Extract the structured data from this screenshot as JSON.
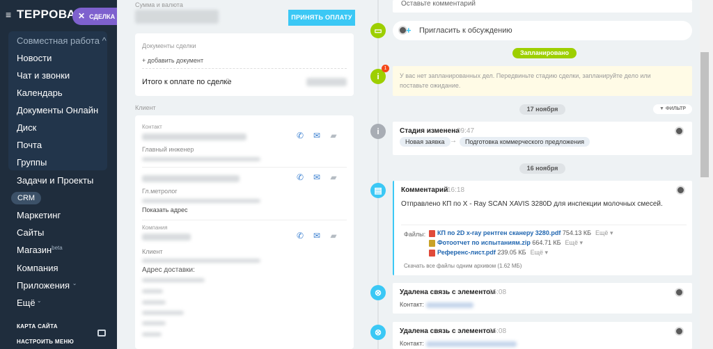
{
  "sidebar": {
    "brand": "ТЕРРОВАК",
    "deal_pill": "СДЕЛКА",
    "group_title": "Совместная работа",
    "items": [
      "Новости",
      "Чат и звонки",
      "Календарь",
      "Документы Онлайн",
      "Диск",
      "Почта",
      "Группы"
    ],
    "items2": [
      "Задачи и Проекты"
    ],
    "crm": "CRM",
    "items3": [
      "Маркетинг",
      "Сайты"
    ],
    "shop": "Магазин",
    "shop_sup": "beta",
    "items4": [
      "Компания"
    ],
    "apps": "Приложения",
    "more": "Ещё",
    "sitemap": "КАРТА САЙТА",
    "settings": "НАСТРОИТЬ МЕНЮ"
  },
  "left": {
    "sum_label": "Сумма и валюта",
    "pay_button": "ПРИНЯТЬ ОПЛАТУ",
    "docs_label": "Документы сделки",
    "add_doc": "+ добавить документ",
    "total_label": "Итого к оплате по сделке",
    "client_label": "Клиент",
    "contact_label": "Контакт",
    "position1": "Главный инженер",
    "position2": "Гл.метролог",
    "show_address": "Показать адрес",
    "company_label": "Компания",
    "client_sub": "Клиент",
    "delivery_label": "Адрес доставки:"
  },
  "timeline": {
    "comment_placeholder": "Оставьте комментарий",
    "invite": "Пригласить к обсуждению",
    "planned": "Запланировано",
    "no_tasks": "У вас нет запланированных дел. Передвиньте стадию сделки, запланируйте дело или поставьте ожидание.",
    "badge_count": "1",
    "date1": "17 ноября",
    "filter": "ФИЛЬТР",
    "stage_title": "Стадия изменена",
    "stage_time": "09:47",
    "stage_from": "Новая заявка",
    "stage_arrow": "→",
    "stage_to": "Подготовка коммерческого предложения",
    "date2": "16 ноября",
    "comment_title": "Комментарий",
    "comment_time": "16:18",
    "comment_text": "Отправлено КП по X - Ray SCAN XAVIS 3280D для инспекции молочных смесей.",
    "files_label": "Файлы:",
    "files": [
      {
        "name": "КП по 2D x-ray рентген сканеру 3280.pdf",
        "size": "754.13 КБ",
        "more": "Ещё"
      },
      {
        "name": "Фотоотчет по испытаниям.zip",
        "size": "664.71 КБ",
        "more": "Ещё"
      },
      {
        "name": "Референс-лист.pdf",
        "size": "239.05 КБ",
        "more": "Ещё"
      }
    ],
    "download_all": "Скачать все файлы одним архивом (1.62 МБ)",
    "removed1_title": "Удалена связь с элементом",
    "removed1_time": "16:08",
    "contact_label": "Контакт:",
    "removed2_title": "Удалена связь с элементом",
    "removed2_time": "16:08"
  },
  "colors": {
    "sidebar": "#1f2d3d",
    "accent": "#3bc8f5",
    "purple": "#7e61ce",
    "green": "#9dcf00",
    "grey_dot": "#a8adb4"
  }
}
